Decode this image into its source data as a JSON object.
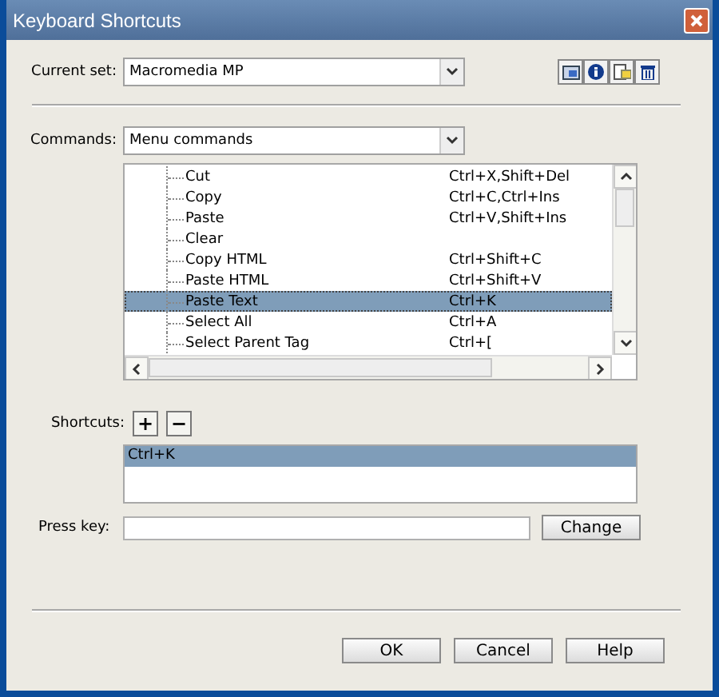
{
  "window": {
    "title": "Keyboard Shortcuts"
  },
  "current_set": {
    "label": "Current set:",
    "value": "Macromedia MP"
  },
  "commands": {
    "label": "Commands:",
    "value": "Menu commands"
  },
  "command_list": [
    {
      "name": "Cut",
      "shortcut": "Ctrl+X,Shift+Del",
      "selected": false
    },
    {
      "name": "Copy",
      "shortcut": "Ctrl+C,Ctrl+Ins",
      "selected": false
    },
    {
      "name": "Paste",
      "shortcut": "Ctrl+V,Shift+Ins",
      "selected": false
    },
    {
      "name": "Clear",
      "selected": false
    },
    {
      "name": "Copy HTML",
      "shortcut": "Ctrl+Shift+C",
      "selected": false
    },
    {
      "name": "Paste HTML",
      "shortcut": "Ctrl+Shift+V",
      "selected": false
    },
    {
      "name": "Paste Text",
      "shortcut": "Ctrl+K",
      "selected": true
    },
    {
      "name": "Select All",
      "shortcut": "Ctrl+A",
      "selected": false
    },
    {
      "name": "Select Parent Tag",
      "shortcut": "Ctrl+[",
      "selected": false
    }
  ],
  "shortcuts": {
    "label": "Shortcuts:",
    "add": "+",
    "remove": "−",
    "items": [
      {
        "text": "Ctrl+K",
        "selected": true
      }
    ]
  },
  "press_key": {
    "label": "Press key:",
    "button": "Change"
  },
  "buttons": [
    "OK",
    "Cancel",
    "Help"
  ]
}
